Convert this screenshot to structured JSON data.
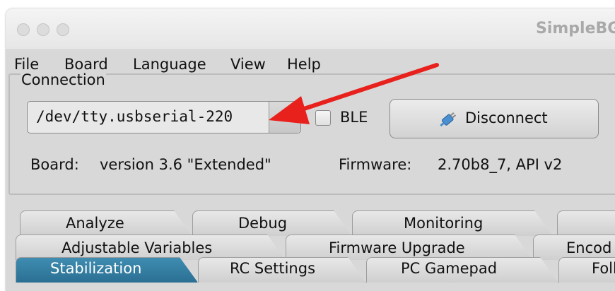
{
  "window": {
    "title": "SimpleBGC"
  },
  "menu": {
    "items": [
      "File",
      "Board",
      "Language",
      "View",
      "Help"
    ]
  },
  "connection": {
    "group_label": "Connection",
    "port_value": "/dev/tty.usbserial-220",
    "ble_label": "BLE",
    "ble_checked": false,
    "disconnect_label": "Disconnect",
    "disconnect_icon": "plug-icon",
    "board_label": "Board:",
    "board_value": "version 3.6 \"Extended\"",
    "firmware_label": "Firmware:",
    "firmware_value": "2.70b8_7, API v2"
  },
  "tabs": {
    "row1": [
      "Analyze",
      "Debug",
      "Monitoring"
    ],
    "row2": [
      "Adjustable Variables",
      "Firmware Upgrade",
      "Encod"
    ],
    "row3": [
      "Stabilization",
      "RC Settings",
      "PC Gamepad",
      "Foll"
    ],
    "active": "Stabilization"
  },
  "annotation": {
    "arrow_color": "#e8211d"
  },
  "colors": {
    "active_tab": "#2f7aa0",
    "window_bg": "#d8d8d8"
  }
}
